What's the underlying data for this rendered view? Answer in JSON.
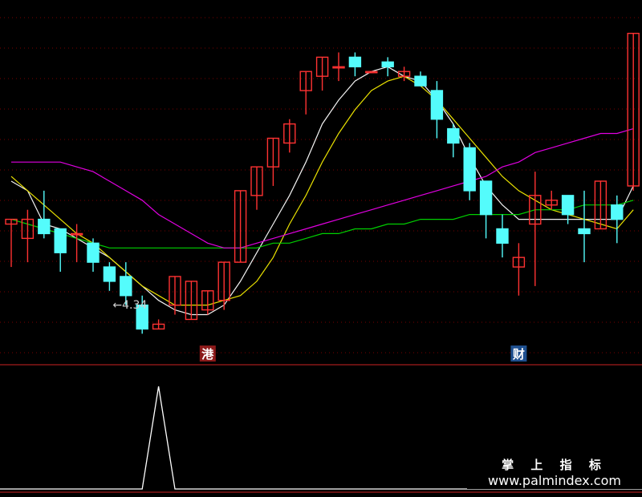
{
  "chart_data": {
    "type": "candlestick",
    "candles": [
      {
        "o": 0.705,
        "h": 0.703,
        "l": 0.696,
        "c": 0.706
      },
      {
        "o": 0.702,
        "h": 0.708,
        "l": 0.697,
        "c": 0.706
      },
      {
        "o": 0.706,
        "h": 0.712,
        "l": 0.702,
        "c": 0.703
      },
      {
        "o": 0.704,
        "h": 0.702,
        "l": 0.695,
        "c": 0.699
      },
      {
        "o": 0.703,
        "h": 0.705,
        "l": 0.697,
        "c": 0.703
      },
      {
        "o": 0.701,
        "h": 0.702,
        "l": 0.695,
        "c": 0.697
      },
      {
        "o": 0.696,
        "h": 0.697,
        "l": 0.691,
        "c": 0.693
      },
      {
        "o": 0.694,
        "h": 0.697,
        "l": 0.688,
        "c": 0.69
      },
      {
        "o": 0.688,
        "h": 0.69,
        "l": 0.682,
        "c": 0.683
      },
      {
        "o": 0.683,
        "h": 0.685,
        "l": 0.683,
        "c": 0.684
      },
      {
        "o": 0.688,
        "h": 0.691,
        "l": 0.686,
        "c": 0.694
      },
      {
        "o": 0.685,
        "h": 0.692,
        "l": 0.686,
        "c": 0.693
      },
      {
        "o": 0.687,
        "h": 0.688,
        "l": 0.686,
        "c": 0.691
      },
      {
        "o": 0.689,
        "h": 0.697,
        "l": 0.687,
        "c": 0.697
      },
      {
        "o": 0.697,
        "h": 0.705,
        "l": 0.697,
        "c": 0.712
      },
      {
        "o": 0.711,
        "h": 0.716,
        "l": 0.708,
        "c": 0.717
      },
      {
        "o": 0.717,
        "h": 0.721,
        "l": 0.713,
        "c": 0.723
      },
      {
        "o": 0.722,
        "h": 0.727,
        "l": 0.72,
        "c": 0.726
      },
      {
        "o": 0.733,
        "h": 0.733,
        "l": 0.728,
        "c": 0.737
      },
      {
        "o": 0.736,
        "h": 0.74,
        "l": 0.733,
        "c": 0.74
      },
      {
        "o": 0.738,
        "h": 0.741,
        "l": 0.735,
        "c": 0.738
      },
      {
        "o": 0.74,
        "h": 0.741,
        "l": 0.736,
        "c": 0.738
      },
      {
        "o": 0.737,
        "h": 0.737,
        "l": 0.737,
        "c": 0.737
      },
      {
        "o": 0.739,
        "h": 0.74,
        "l": 0.736,
        "c": 0.738
      },
      {
        "o": 0.736,
        "h": 0.738,
        "l": 0.735,
        "c": 0.737
      },
      {
        "o": 0.736,
        "h": 0.737,
        "l": 0.734,
        "c": 0.734
      },
      {
        "o": 0.733,
        "h": 0.735,
        "l": 0.723,
        "c": 0.727
      },
      {
        "o": 0.725,
        "h": 0.726,
        "l": 0.719,
        "c": 0.722
      },
      {
        "o": 0.721,
        "h": 0.722,
        "l": 0.71,
        "c": 0.712
      },
      {
        "o": 0.714,
        "h": 0.714,
        "l": 0.702,
        "c": 0.707
      },
      {
        "o": 0.704,
        "h": 0.707,
        "l": 0.698,
        "c": 0.701
      },
      {
        "o": 0.696,
        "h": 0.701,
        "l": 0.69,
        "c": 0.698
      },
      {
        "o": 0.705,
        "h": 0.716,
        "l": 0.692,
        "c": 0.711
      },
      {
        "o": 0.709,
        "h": 0.712,
        "l": 0.708,
        "c": 0.71
      },
      {
        "o": 0.711,
        "h": 0.709,
        "l": 0.705,
        "c": 0.707
      },
      {
        "o": 0.704,
        "h": 0.712,
        "l": 0.697,
        "c": 0.703
      },
      {
        "o": 0.704,
        "h": 0.714,
        "l": 0.705,
        "c": 0.714
      },
      {
        "o": 0.709,
        "h": 0.711,
        "l": 0.701,
        "c": 0.706
      },
      {
        "o": 0.713,
        "h": 0.744,
        "l": 0.712,
        "c": 0.745
      }
    ],
    "moving_averages": [
      {
        "color": "#f2f2f2",
        "values": [
          0.714,
          0.712,
          0.705,
          0.704,
          0.702,
          0.7,
          0.698,
          0.695,
          0.692,
          0.689,
          0.687,
          0.686,
          0.686,
          0.688,
          0.693,
          0.699,
          0.705,
          0.711,
          0.718,
          0.726,
          0.731,
          0.735,
          0.737,
          0.738,
          0.736,
          0.735,
          0.731,
          0.726,
          0.719,
          0.713,
          0.709,
          0.706,
          0.706,
          0.706,
          0.706,
          0.706,
          0.706,
          0.706,
          0.713
        ]
      },
      {
        "color": "#e8e000",
        "values": [
          0.715,
          0.712,
          0.709,
          0.706,
          0.703,
          0.701,
          0.698,
          0.695,
          0.692,
          0.69,
          0.688,
          0.688,
          0.688,
          0.689,
          0.69,
          0.693,
          0.698,
          0.705,
          0.711,
          0.718,
          0.724,
          0.729,
          0.733,
          0.735,
          0.736,
          0.734,
          0.731,
          0.727,
          0.723,
          0.719,
          0.715,
          0.712,
          0.71,
          0.708,
          0.707,
          0.706,
          0.705,
          0.704,
          0.708
        ]
      },
      {
        "color": "#00d000",
        "values": [
          0.706,
          0.705,
          0.704,
          0.703,
          0.702,
          0.701,
          0.7,
          0.7,
          0.7,
          0.7,
          0.7,
          0.7,
          0.7,
          0.7,
          0.7,
          0.7,
          0.701,
          0.701,
          0.702,
          0.703,
          0.703,
          0.704,
          0.704,
          0.705,
          0.705,
          0.706,
          0.706,
          0.706,
          0.707,
          0.707,
          0.707,
          0.707,
          0.708,
          0.708,
          0.708,
          0.709,
          0.709,
          0.709,
          0.71
        ]
      },
      {
        "color": "#e000e0",
        "values": [
          0.718,
          0.718,
          0.718,
          0.718,
          0.717,
          0.716,
          0.714,
          0.712,
          0.71,
          0.707,
          0.705,
          0.703,
          0.701,
          0.7,
          0.7,
          0.701,
          0.702,
          0.703,
          0.704,
          0.705,
          0.706,
          0.707,
          0.708,
          0.709,
          0.71,
          0.711,
          0.712,
          0.713,
          0.714,
          0.715,
          0.717,
          0.718,
          0.72,
          0.721,
          0.722,
          0.723,
          0.724,
          0.724,
          0.725
        ]
      }
    ],
    "annotations": [
      {
        "text": "←4.34",
        "candle": 6,
        "color": "#cfcfcf"
      }
    ],
    "badges": [
      {
        "text": "港",
        "candle": 12,
        "color": "#8b1a1a"
      },
      {
        "text": "财",
        "candle": 31,
        "color": "#1e4f8f"
      }
    ],
    "indicator": {
      "values": [
        0,
        0,
        0,
        0,
        0,
        0,
        0,
        0,
        0,
        1,
        0,
        0,
        0,
        0,
        0,
        0,
        0,
        0,
        0,
        0,
        0,
        0,
        0,
        0,
        0,
        0,
        0,
        0,
        0,
        0,
        0,
        0,
        0,
        0,
        0,
        0,
        0,
        0,
        0
      ],
      "color": "#ffffff"
    },
    "colors": {
      "up": "#ff3232",
      "down": "#54fcfc",
      "grid": "#7a0000",
      "separator": "#cc2222",
      "background": "#000000"
    }
  },
  "watermark": {
    "line1": "掌 上 指 标",
    "line2": "www.palmindex.com"
  }
}
